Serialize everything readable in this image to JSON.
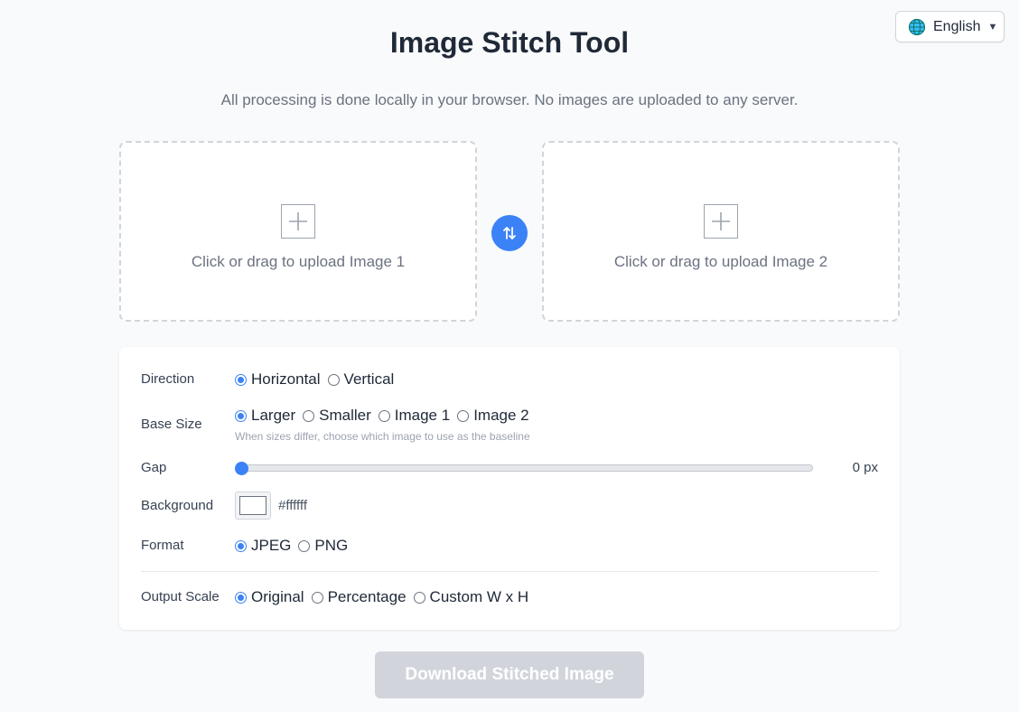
{
  "language": {
    "selected": "English",
    "icon": "globe-icon"
  },
  "header": {
    "title": "Image Stitch Tool",
    "subtitle": "All processing is done locally in your browser. No images are uploaded to any server."
  },
  "uploads": {
    "image1_label": "Click or drag to upload Image 1",
    "image2_label": "Click or drag to upload Image 2",
    "swap_icon": "swap-icon"
  },
  "settings": {
    "direction": {
      "label": "Direction",
      "options": [
        "Horizontal",
        "Vertical"
      ],
      "selected": "Horizontal"
    },
    "base_size": {
      "label": "Base Size",
      "options": [
        "Larger",
        "Smaller",
        "Image 1",
        "Image 2"
      ],
      "selected": "Larger",
      "hint": "When sizes differ, choose which image to use as the baseline"
    },
    "gap": {
      "label": "Gap",
      "value": 0,
      "value_text": "0 px"
    },
    "background": {
      "label": "Background",
      "color": "#ffffff",
      "hex_text": "#ffffff"
    },
    "format": {
      "label": "Format",
      "options": [
        "JPEG",
        "PNG"
      ],
      "selected": "JPEG"
    },
    "output_scale": {
      "label": "Output Scale",
      "options": [
        "Original",
        "Percentage",
        "Custom W x H"
      ],
      "selected": "Original"
    }
  },
  "download": {
    "label": "Download Stitched Image",
    "disabled": true
  },
  "colors": {
    "accent": "#3b82f6",
    "disabled_button": "#d1d5db",
    "page_bg": "#f9fafb"
  }
}
